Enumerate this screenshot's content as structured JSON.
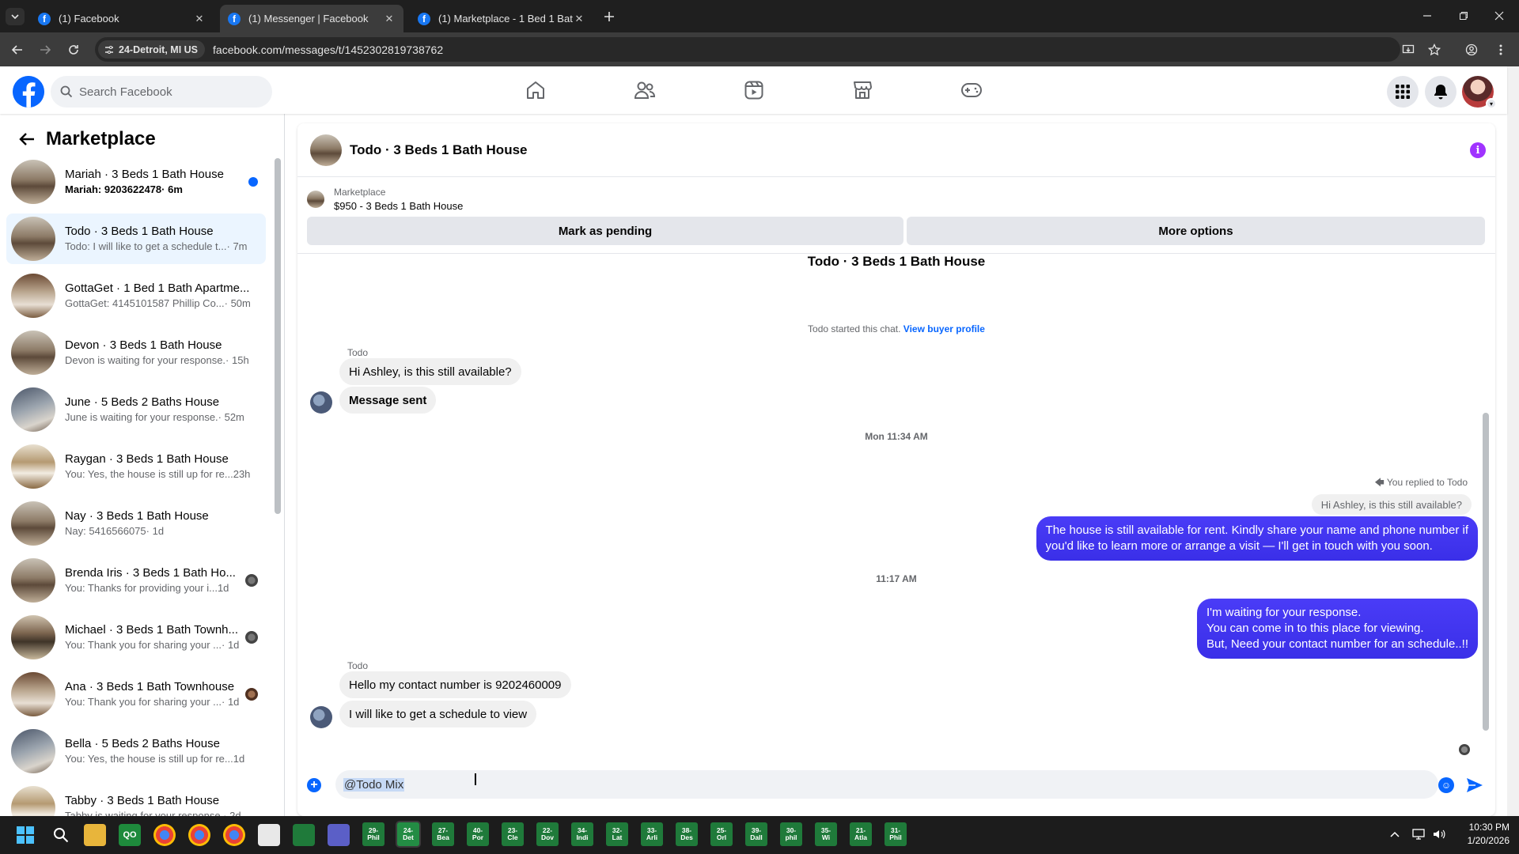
{
  "browser": {
    "tabs": [
      {
        "title": "(1) Facebook",
        "active": false
      },
      {
        "title": "(1) Messenger | Facebook",
        "active": true
      },
      {
        "title": "(1) Marketplace - 1 Bed 1 Bath",
        "active": false
      }
    ],
    "location_chip": "24-Detroit, MI US",
    "url": "facebook.com/messages/t/1452302819738762"
  },
  "fb": {
    "search_placeholder": "Search Facebook"
  },
  "sidebar": {
    "title": "Marketplace",
    "conversations": [
      {
        "name": "Mariah · 3 Beds 1 Bath House",
        "preview": "Mariah: 9203622478",
        "time": " · 6m",
        "unread": true
      },
      {
        "name": "Todo · 3 Beds 1 Bath House",
        "preview": "Todo: I will like to get a schedule t...",
        "time": " · 7m",
        "active": true
      },
      {
        "name": "GottaGet · 1 Bed 1 Bath Apartme...",
        "preview": "GottaGet: 4145101587 Phillip Co...",
        "time": " · 50m"
      },
      {
        "name": "Devon · 3 Beds 1 Bath House",
        "preview": "Devon is waiting for your response.",
        "time": " · 15h"
      },
      {
        "name": "June · 5 Beds 2 Baths House",
        "preview": "June is waiting for your response.",
        "time": " · 52m"
      },
      {
        "name": "Raygan · 3 Beds 1 Bath House",
        "preview": "You: Yes, the house is still up for re...",
        "time": " 23h"
      },
      {
        "name": "Nay · 3 Beds 1 Bath House",
        "preview": "Nay: 5416566075",
        "time": " · 1d"
      },
      {
        "name": "Brenda Iris · 3 Beds 1 Bath Ho...",
        "preview": "You: Thanks for providing your i...",
        "time": " 1d"
      },
      {
        "name": "Michael · 3 Beds 1 Bath Townh...",
        "preview": "You: Thank you for sharing your ...",
        "time": " · 1d"
      },
      {
        "name": "Ana · 3 Beds 1 Bath Townhouse",
        "preview": "You: Thank you for sharing your ...",
        "time": " · 1d"
      },
      {
        "name": "Bella · 5 Beds 2 Baths House",
        "preview": "You: Yes, the house is still up for re...",
        "time": " 1d"
      },
      {
        "name": "Tabby · 3 Beds 1 Bath House",
        "preview": "Tabby is waiting for your response.",
        "time": " · 2d"
      }
    ]
  },
  "chat": {
    "title": "Todo · 3 Beds 1 Bath House",
    "listing_label": "Marketplace",
    "listing_price": "$950 - 3 Beds 1 Bath House",
    "mark_pending": "Mark as pending",
    "more_options": "More options",
    "thread_title": "Todo · 3 Beds 1 Bath House",
    "started_text": "Todo started this chat.",
    "view_profile": "View buyer profile",
    "sender1": "Todo",
    "msg1": "Hi Ashley, is this still available?",
    "msg2": "Message sent",
    "stamp1": "Mon 11:34 AM",
    "reply_info": "You replied to Todo",
    "quoted": "Hi Ashley, is this still available?",
    "out1_line1": "The house is still available for rent. Kindly share your name and phone number if",
    "out1_line2": "you'd like to learn more or arrange a visit — I'll get in touch with you soon.",
    "stamp2": "11:17 AM",
    "out2_line1": "I'm waiting for your response.",
    "out2_line2": "You can come in to this place for viewing.",
    "out2_line3": "But, Need your contact number for an schedule..!!",
    "sender2": "Todo",
    "msg3": "Hello my contact number is 9202460009",
    "msg4": "I will like to get a schedule to view",
    "composer_value": "@Todo Mix"
  },
  "taskbar": {
    "dated_apps": [
      {
        "l1": "29-",
        "l2": "Phil"
      },
      {
        "l1": "24-",
        "l2": "Det"
      },
      {
        "l1": "27-",
        "l2": "Bea"
      },
      {
        "l1": "40-",
        "l2": "Por"
      },
      {
        "l1": "23-",
        "l2": "Cle"
      },
      {
        "l1": "22-",
        "l2": "Dov"
      },
      {
        "l1": "34-",
        "l2": "Indi"
      },
      {
        "l1": "32-",
        "l2": "Lat"
      },
      {
        "l1": "33-",
        "l2": "Arli"
      },
      {
        "l1": "38-",
        "l2": "Des"
      },
      {
        "l1": "25-",
        "l2": "Orl"
      },
      {
        "l1": "39-",
        "l2": "Dall"
      },
      {
        "l1": "30-",
        "l2": "phil"
      },
      {
        "l1": "35-",
        "l2": "Wi"
      },
      {
        "l1": "21-",
        "l2": "Atla"
      },
      {
        "l1": "31-",
        "l2": "Phil"
      }
    ],
    "time": "10:30 PM",
    "date": "1/20/2026"
  },
  "colors": {
    "accent": "#0866ff",
    "outgoing_bubble": "#3b2ff5",
    "active_conv": "#ebf5ff"
  }
}
